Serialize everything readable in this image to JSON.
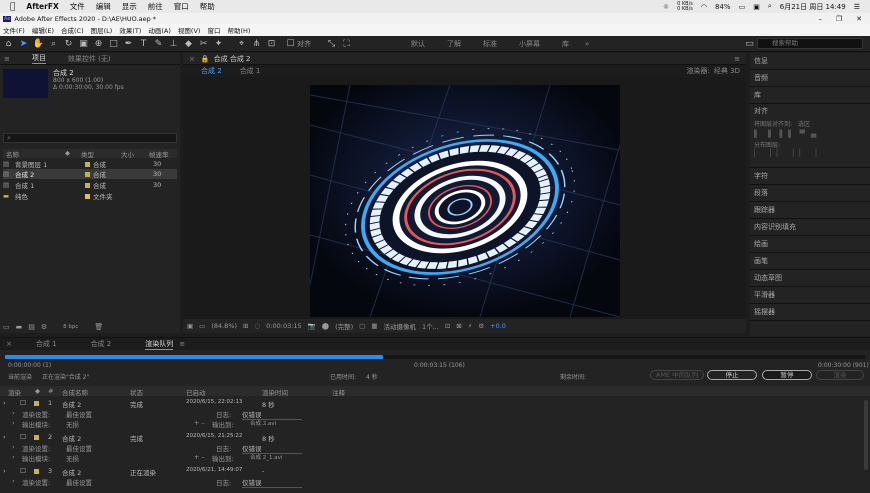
{
  "mac_menubar": {
    "app": "AfterFX",
    "menus": [
      "文件",
      "编辑",
      "显示",
      "前往",
      "窗口",
      "帮助"
    ],
    "net_up": "0 KB/s",
    "net_down": "0 KB/s",
    "battery": "84%",
    "datetime": "6月21日 周日 14:49"
  },
  "window_title": "Adobe After Effects 2020 - D:\\AE\\HUO.aep *",
  "app_menu": [
    "文件(F)",
    "编辑(E)",
    "合成(C)",
    "图层(L)",
    "效果(T)",
    "动画(A)",
    "视图(V)",
    "窗口",
    "帮助(H)"
  ],
  "toolbar": {
    "align_label": "对齐",
    "workspaces": [
      "默认",
      "了解",
      "标准",
      "小屏幕",
      "库"
    ],
    "search_placeholder": "搜索帮助"
  },
  "project_panel": {
    "tabs": [
      "项目",
      "效果控件 (无)"
    ],
    "selected_name": "合成 2",
    "selected_size": "800 x 600 (1.00)",
    "selected_duration": "Δ 0:00:30:00, 30.00 fps",
    "columns": [
      "名称",
      "类型",
      "大小",
      "帧速率"
    ],
    "items": [
      {
        "name": "背景图层 1",
        "type": "合成",
        "fps": "30"
      },
      {
        "name": "合成 2",
        "type": "合成",
        "fps": "30"
      },
      {
        "name": "合成 1",
        "type": "合成",
        "fps": "30"
      },
      {
        "name": "纯色",
        "type": "文件夹",
        "fps": ""
      }
    ],
    "bpc": "8 bpc"
  },
  "comp_panel": {
    "title": "合成 合成 2",
    "tabs": [
      "合成 2",
      "合成 1"
    ],
    "renderer_label": "渲染器:",
    "renderer_value": "经典 3D",
    "zoom": "(84.8%)",
    "timecode": "0:00:03:15",
    "quality": "(完整)",
    "camera": "活动摄像机",
    "views": "1个...",
    "exposure": "+0.0"
  },
  "right_panels": {
    "items": [
      "信息",
      "音频",
      "库",
      "对齐",
      "字符",
      "段落",
      "跟踪器",
      "内容识别填充",
      "绘画",
      "画笔",
      "动态草图",
      "平滑器",
      "摇摆器"
    ],
    "align_to": "将图层对齐到:",
    "align_to_value": "选区",
    "distribute": "分布图层:"
  },
  "queue": {
    "tabs": [
      "合成 1",
      "合成 2",
      "渲染队列"
    ],
    "start_time": "0:00:00:00 (1)",
    "current_time": "0:00:03:15 (106)",
    "end_time": "0:00:30:00 (901)",
    "status_label": "当前渲染",
    "status_value": "正在渲染\"合成 2\"",
    "elapsed_label": "已用时间:",
    "elapsed_value": "4 秒",
    "remaining_label": "剩余时间:",
    "ame_button": "AME 中的队列",
    "stop_button": "停止",
    "pause_button": "暂停",
    "render_button": "渲染",
    "progress": 0.44,
    "columns": [
      "渲染",
      "#",
      "合成名称",
      "状态",
      "已启动",
      "渲染时间",
      "注释"
    ],
    "rows": [
      {
        "num": "1",
        "name": "合成 2",
        "status": "完成",
        "started": "2020/6/15, 22:02:13",
        "time": "8 秒",
        "settings": "最佳设置",
        "log": "仅错误",
        "module": "无损",
        "output": "合成 2.avi"
      },
      {
        "num": "2",
        "name": "合成 2",
        "status": "完成",
        "started": "2020/6/15, 21:25:22",
        "time": "8 秒",
        "settings": "最佳设置",
        "log": "仅错误",
        "module": "无损",
        "output": "合成 2_1.avi"
      },
      {
        "num": "3",
        "name": "合成 2",
        "status": "正在渲染",
        "started": "2020/6/21, 14:49:07",
        "time": "-",
        "settings": "最佳设置",
        "log": "仅错误",
        "module": "",
        "output": ""
      }
    ],
    "settings_label": "渲染设置:",
    "module_label": "输出模块:",
    "log_label": "日志:",
    "output_label": "输出到:"
  }
}
